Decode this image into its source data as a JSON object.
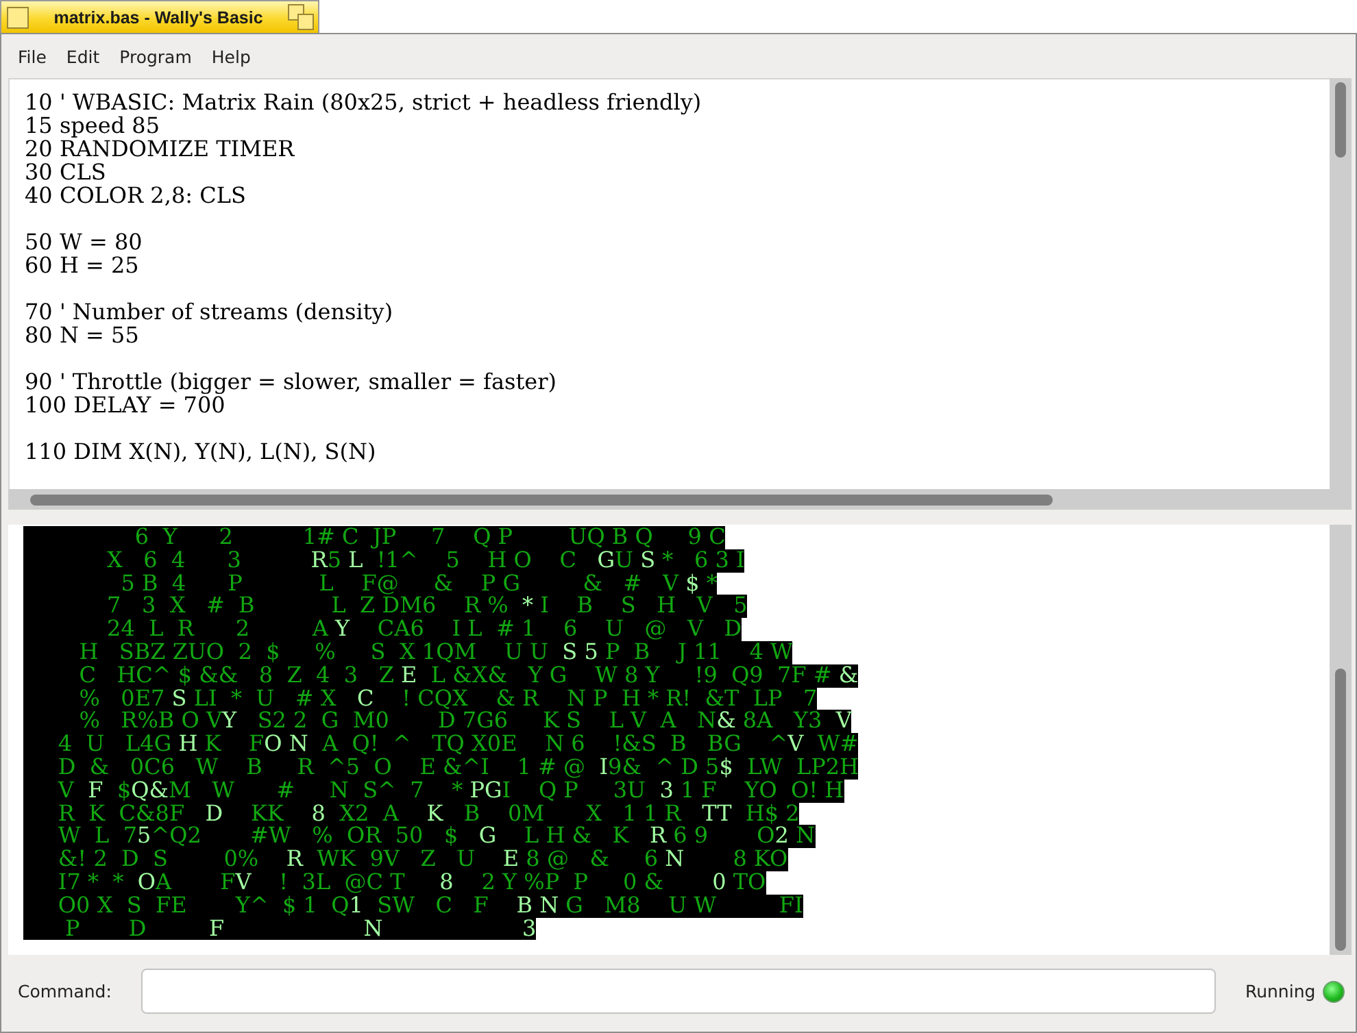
{
  "window": {
    "title": "matrix.bas - Wally's Basic"
  },
  "menu": [
    "File",
    "Edit",
    "Program",
    "Help"
  ],
  "editor": {
    "blocks": [
      [
        "10 ' WBASIC: Matrix Rain (80x25, strict + headless friendly)",
        "15 speed 85",
        "20 RANDOMIZE TIMER",
        "30 CLS",
        "40 COLOR 2,8: CLS"
      ],
      [
        "50 W = 80",
        "60 H = 25"
      ],
      [
        "70 ' Number of streams (density)",
        "80 N = 55"
      ],
      [
        "90 ' Throttle (bigger = slower, smaller = faster)",
        "100 DELAY = 700"
      ],
      [
        "110 DIM X(N), Y(N), L(N), S(N)"
      ]
    ]
  },
  "output": {
    "lines": [
      [
        {
          "text": "                6  Y      2          1# C  JP     7    Q P        UQ B Q     9 C",
          "bright": false
        }
      ],
      [
        {
          "text": "            X   6  4      3          ",
          "bright": false
        },
        {
          "text": "R",
          "bright": true
        },
        {
          "text": "5 ",
          "bright": false
        },
        {
          "text": "L",
          "bright": true
        },
        {
          "text": "  !1^    5    H O    C   ",
          "bright": false
        },
        {
          "text": "G",
          "bright": true
        },
        {
          "text": "U ",
          "bright": false
        },
        {
          "text": "S",
          "bright": true
        },
        {
          "text": " *   6 3 I",
          "bright": false
        }
      ],
      [
        {
          "text": "              5 B  4      P           L    F@     &    P G         &   #   V ",
          "bright": false
        },
        {
          "text": "$",
          "bright": true
        },
        {
          "text": " *",
          "bright": false
        }
      ],
      [
        {
          "text": "            7   3  X   #  B           L  Z DM6    R %  ",
          "bright": false
        },
        {
          "text": "*",
          "bright": true
        },
        {
          "text": " I    B    S   H   V   5",
          "bright": false
        }
      ],
      [
        {
          "text": "            24  L  R      2         A ",
          "bright": false
        },
        {
          "text": "Y",
          "bright": true
        },
        {
          "text": "    CA6    I L  # 1    6    U   @   V   D",
          "bright": false
        }
      ],
      [
        {
          "text": "        H   SBZ ZUO  2  $     %     S  X 1QM    U U  ",
          "bright": false
        },
        {
          "text": "S 5",
          "bright": true
        },
        {
          "text": " P  B    J 11    4 W",
          "bright": false
        }
      ],
      [
        {
          "text": "        C   HC^ $ &&   8  Z  4  3   Z ",
          "bright": false
        },
        {
          "text": "E",
          "bright": true
        },
        {
          "text": "  L &X&   Y G    W 8 Y     !9  Q9  7F # ",
          "bright": false
        },
        {
          "text": "&",
          "bright": true
        }
      ],
      [
        {
          "text": "        %   0E7 ",
          "bright": false
        },
        {
          "text": "S",
          "bright": true
        },
        {
          "text": " LI  *  U   # X   ",
          "bright": false
        },
        {
          "text": "C",
          "bright": true
        },
        {
          "text": "    ! CQX    & R    N P  H * R!  &T  LP   7",
          "bright": false
        }
      ],
      [
        {
          "text": "        %   R%B O V",
          "bright": false
        },
        {
          "text": "Y",
          "bright": true
        },
        {
          "text": "   S2 2  G  M0       D 7G6     K S    L V  A   N",
          "bright": false
        },
        {
          "text": "&",
          "bright": true
        },
        {
          "text": " 8A   Y3  ",
          "bright": false
        },
        {
          "text": "V",
          "bright": true
        }
      ],
      [
        {
          "text": "     4  U   L4G ",
          "bright": false
        },
        {
          "text": "H",
          "bright": true
        },
        {
          "text": " K    F",
          "bright": false
        },
        {
          "text": "O N",
          "bright": true
        },
        {
          "text": "  A  Q!  ^   TQ X0E    N 6    !&S  B   BG    ^",
          "bright": false
        },
        {
          "text": "V",
          "bright": true
        },
        {
          "text": "  W#",
          "bright": false
        }
      ],
      [
        {
          "text": "     D  &   0C6   W    B     R  ^5  O    E &^I    1 # @  ",
          "bright": false
        },
        {
          "text": "I",
          "bright": true
        },
        {
          "text": "9&  ^ D 5",
          "bright": false
        },
        {
          "text": "$",
          "bright": true
        },
        {
          "text": "  LW  LP2H",
          "bright": false
        }
      ],
      [
        {
          "text": "     V  ",
          "bright": false
        },
        {
          "text": "F",
          "bright": true
        },
        {
          "text": "  $",
          "bright": false
        },
        {
          "text": "Q&",
          "bright": true
        },
        {
          "text": "M   W      #     N  S^  7    * ",
          "bright": false
        },
        {
          "text": "PG",
          "bright": true
        },
        {
          "text": "I    Q P     3U  ",
          "bright": false
        },
        {
          "text": "3",
          "bright": true
        },
        {
          "text": " 1 F    YO  O! H",
          "bright": false
        }
      ],
      [
        {
          "text": "     R  K  C&8F   ",
          "bright": false
        },
        {
          "text": "D",
          "bright": true
        },
        {
          "text": "    KK    ",
          "bright": false
        },
        {
          "text": "8",
          "bright": true
        },
        {
          "text": "  X2  A    ",
          "bright": false
        },
        {
          "text": "K",
          "bright": true
        },
        {
          "text": "   B    0M      X   1 1 R   ",
          "bright": false
        },
        {
          "text": "TT",
          "bright": true
        },
        {
          "text": "  H$ 2",
          "bright": false
        }
      ],
      [
        {
          "text": "     W  L  7",
          "bright": false
        },
        {
          "text": "5",
          "bright": true
        },
        {
          "text": "^Q2       #W   %  OR  50   $   ",
          "bright": false
        },
        {
          "text": "G",
          "bright": true
        },
        {
          "text": "    L H &   K   ",
          "bright": false
        },
        {
          "text": "R",
          "bright": true
        },
        {
          "text": " 6 9       O",
          "bright": false
        },
        {
          "text": "2",
          "bright": true
        },
        {
          "text": " N",
          "bright": false
        }
      ],
      [
        {
          "text": "     &! 2  D  S        0%    ",
          "bright": false
        },
        {
          "text": "R",
          "bright": true
        },
        {
          "text": "  WK  9V   Z   U    ",
          "bright": false
        },
        {
          "text": "E",
          "bright": true
        },
        {
          "text": " 8 @   &     6 ",
          "bright": false
        },
        {
          "text": "N",
          "bright": true
        },
        {
          "text": "       8 KO",
          "bright": false
        }
      ],
      [
        {
          "text": "     I7 *  *  ",
          "bright": false
        },
        {
          "text": "O",
          "bright": true
        },
        {
          "text": "A       F",
          "bright": false
        },
        {
          "text": "V",
          "bright": true
        },
        {
          "text": "    !  3L  @C T     ",
          "bright": false
        },
        {
          "text": "8",
          "bright": true
        },
        {
          "text": "    2 Y %P  P     0 &       ",
          "bright": false
        },
        {
          "text": "0",
          "bright": true
        },
        {
          "text": " TO",
          "bright": false
        }
      ],
      [
        {
          "text": "     O0 X  S  FE       Y^  $ 1  Q",
          "bright": false
        },
        {
          "text": "1",
          "bright": true
        },
        {
          "text": "  SW   C   F    ",
          "bright": false
        },
        {
          "text": "B N",
          "bright": true
        },
        {
          "text": " G   M8    U W         FI",
          "bright": false
        }
      ],
      [
        {
          "text": "      P       D         ",
          "bright": false
        },
        {
          "text": "F                    N                    3",
          "bright": true
        }
      ]
    ]
  },
  "command": {
    "label": "Command:"
  },
  "status": {
    "label": "Running",
    "active": true
  }
}
